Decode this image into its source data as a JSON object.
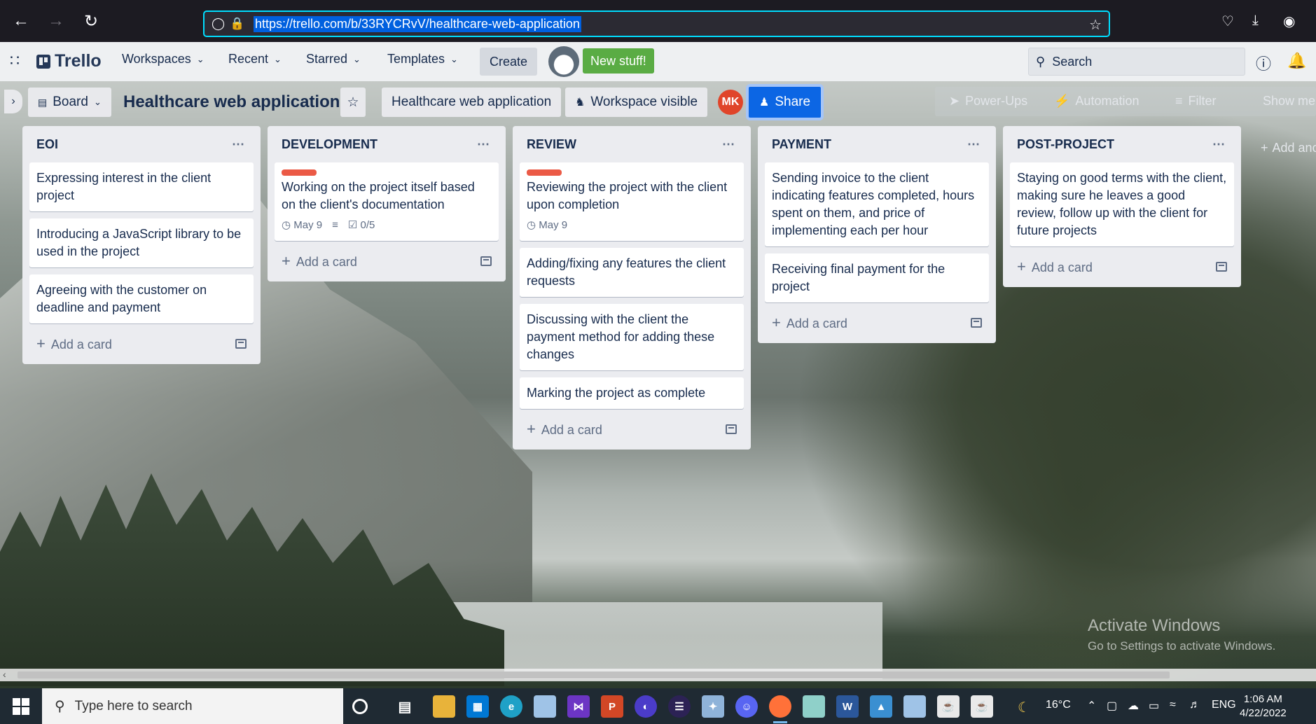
{
  "browser": {
    "url": "https://trello.com/b/33RYCRvV/healthcare-web-application"
  },
  "header": {
    "logo_text": "Trello",
    "workspaces": "Workspaces",
    "recent": "Recent",
    "starred": "Starred",
    "templates": "Templates",
    "create": "Create",
    "new_stuff": "New stuff!",
    "search_placeholder": "Search"
  },
  "board": {
    "view_label": "Board",
    "title": "Healthcare web application",
    "workspace_name": "Healthcare web application",
    "visibility": "Workspace visible",
    "avatar_initials": "MK",
    "share": "Share",
    "power_ups": "Power-Ups",
    "automation": "Automation",
    "filter": "Filter",
    "show_menu": "Show menu",
    "add_another_list": "Add another list",
    "add_card_label": "Add a card"
  },
  "lists": [
    {
      "title": "EOI",
      "cards": [
        {
          "text": "Expressing interest in the client project"
        },
        {
          "text": "Introducing a JavaScript library to be used in the project"
        },
        {
          "text": "Agreeing with the customer on deadline and payment"
        }
      ]
    },
    {
      "title": "DEVELOPMENT",
      "cards": [
        {
          "text": "Working on the project itself based on the client's documentation",
          "label_color": "#eb5a46",
          "due": "May 9",
          "checklist": "0/5",
          "has_description": true
        }
      ]
    },
    {
      "title": "REVIEW",
      "cards": [
        {
          "text": "Reviewing the project with the client upon completion",
          "label_color": "#eb5a46",
          "due": "May 9"
        },
        {
          "text": "Adding/fixing any features the client requests"
        },
        {
          "text": "Discussing with the client the payment method for adding these changes"
        },
        {
          "text": "Marking the project as complete"
        }
      ]
    },
    {
      "title": "PAYMENT",
      "cards": [
        {
          "text": "Sending invoice to the client indicating features completed, hours spent on them, and price of implementing each per hour"
        },
        {
          "text": "Receiving final payment for the project"
        }
      ]
    },
    {
      "title": "POST-PROJECT",
      "cards": [
        {
          "text": "Staying on good terms with the client, making sure he leaves a good review, follow up with the client for future projects"
        }
      ]
    }
  ],
  "watermark": {
    "line1": "Activate Windows",
    "line2": "Go to Settings to activate Windows."
  },
  "taskbar": {
    "search_placeholder": "Type here to search",
    "weather": "16°C",
    "language": "ENG",
    "time": "1:06 AM",
    "date": "4/22/2022"
  },
  "colors": {
    "share_blue": "#0c66e4",
    "new_stuff_green": "#5aac44",
    "card_label_red": "#eb5a46",
    "url_focus": "#00ddff"
  }
}
